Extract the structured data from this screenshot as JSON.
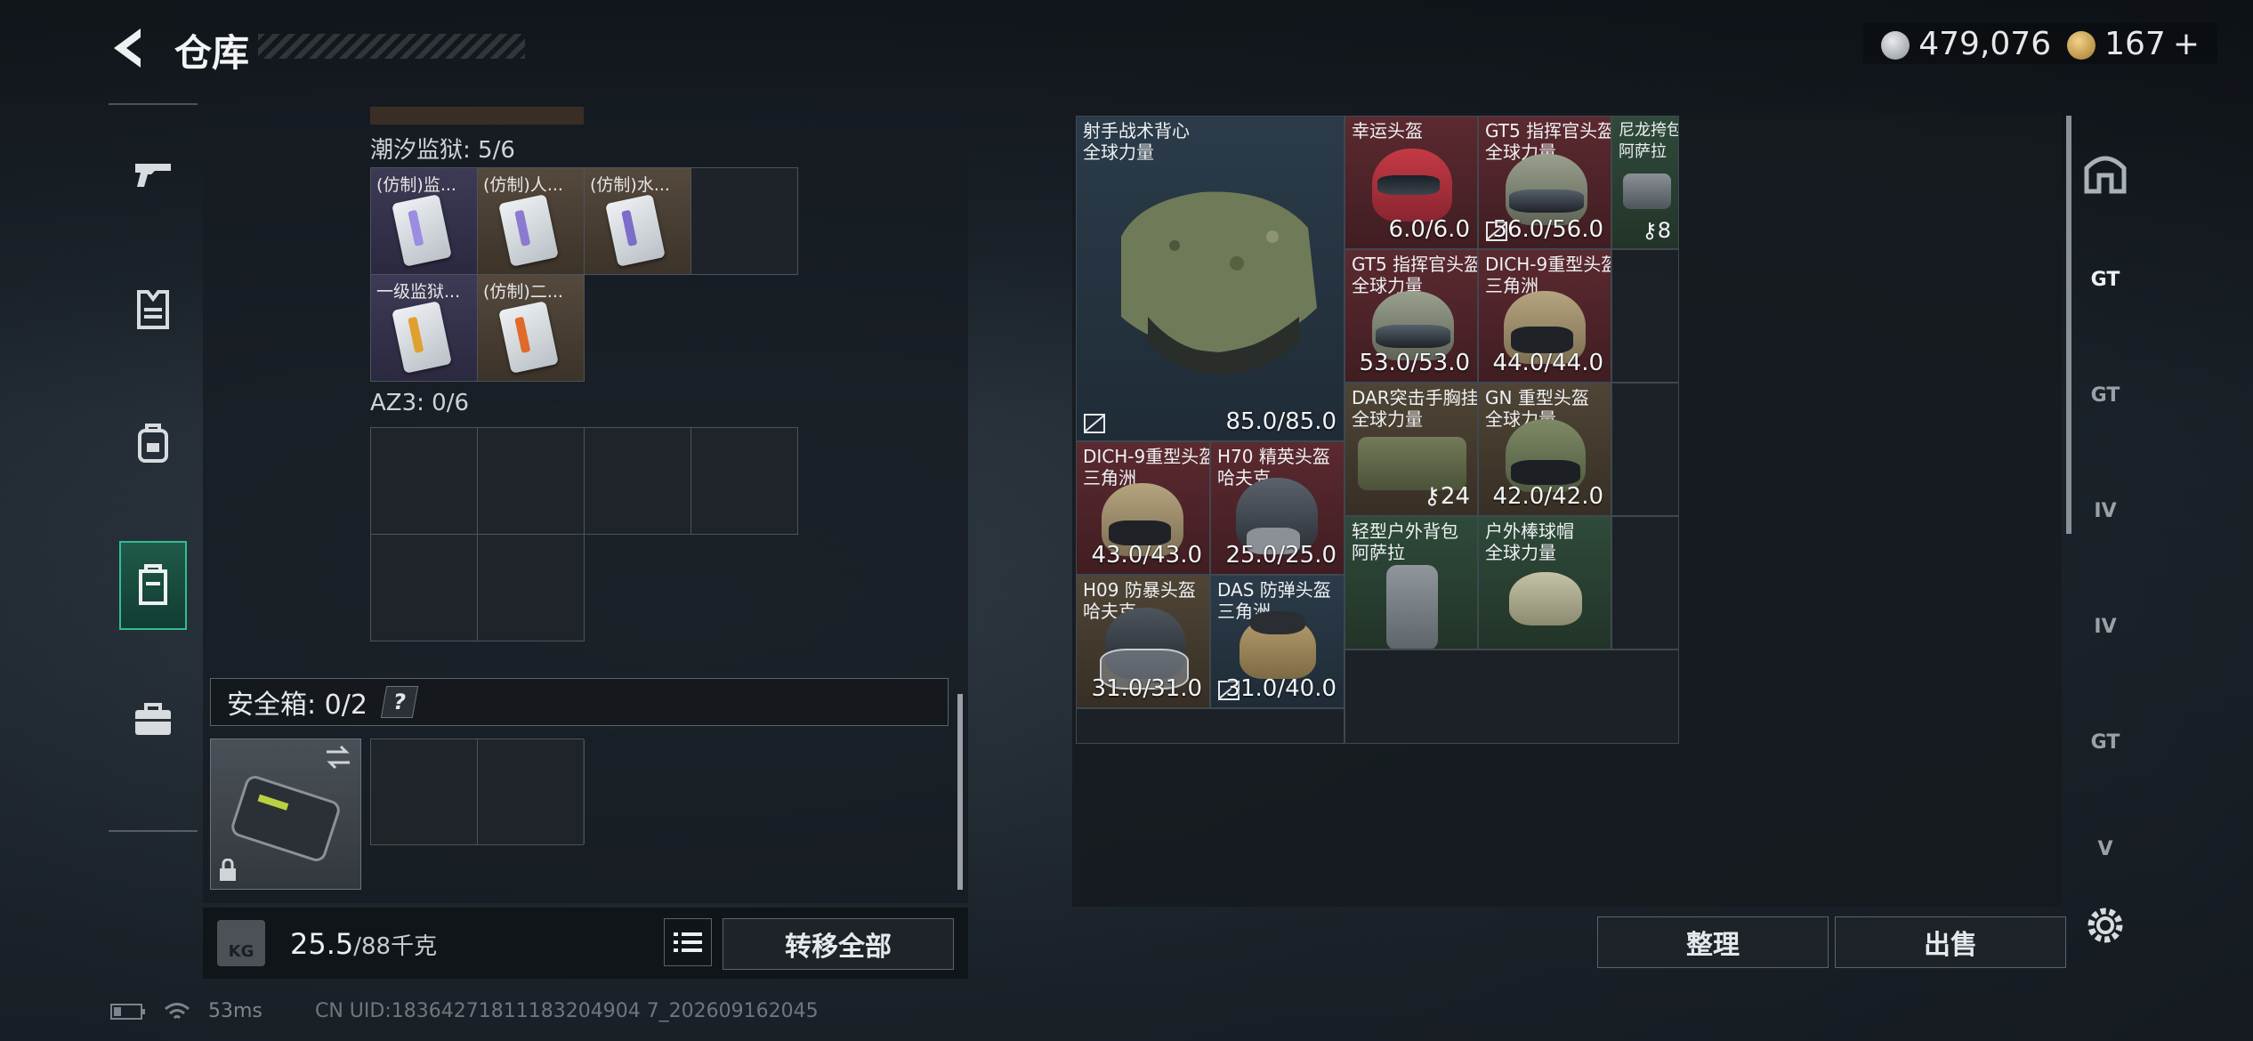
{
  "header": {
    "title": "仓库",
    "silver_amount": "479,076",
    "gold_amount": "167",
    "gold_plus": "+"
  },
  "left_panel": {
    "section1_label": "潮汐监狱: 5/6",
    "section1_items": [
      {
        "name": "(仿制)监...",
        "rarity": "purple",
        "stripe": "#9b8de0"
      },
      {
        "name": "(仿制)人...",
        "rarity": "brown",
        "stripe": "#8c7ad0"
      },
      {
        "name": "(仿制)水...",
        "rarity": "brown",
        "stripe": "#7b6dc8"
      },
      {
        "name": "一级监狱...",
        "rarity": "purple",
        "stripe": "#e0a030"
      },
      {
        "name": "(仿制)二...",
        "rarity": "brown",
        "stripe": "#e06a2a"
      }
    ],
    "section2_label": "AZ3: 0/6",
    "safe_box_label": "安全箱: 0/2",
    "help_label": "?",
    "weight_value": "25.5",
    "weight_capacity": "/88千克",
    "kg_label": "KG",
    "transfer_all_label": "转移全部"
  },
  "storage": {
    "items": [
      {
        "name": "射手战术背心\n全球力量",
        "rarity": "blue",
        "durability": "85.0/85.0",
        "broken_icon": true
      },
      {
        "name": "幸运头盔",
        "rarity": "red",
        "durability": "6.0/6.0"
      },
      {
        "name": "GT5 指挥官头盔\n全球力量",
        "rarity": "red",
        "durability": "56.0/56.0",
        "broken_icon": true
      },
      {
        "name": "尼龙挎包\n阿萨拉",
        "rarity": "green",
        "count": "8"
      },
      {
        "name": "GT5 指挥官头盔\n全球力量",
        "rarity": "red",
        "durability": "53.0/53.0"
      },
      {
        "name": "DICH-9重型头盔\n三角洲",
        "rarity": "red",
        "durability": "44.0/44.0"
      },
      {
        "name": "DICH-9重型头盔\n三角洲",
        "rarity": "red",
        "durability": "43.0/43.0"
      },
      {
        "name": "H70 精英头盔\n哈夫克",
        "rarity": "red",
        "durability": "25.0/25.0"
      },
      {
        "name": "DAR突击手胸挂\n全球力量",
        "rarity": "brown",
        "count": "24"
      },
      {
        "name": "GN 重型头盔\n全球力量",
        "rarity": "brown",
        "durability": "42.0/42.0"
      },
      {
        "name": "H09 防暴头盔\n哈夫克",
        "rarity": "brown",
        "durability": "31.0/31.0"
      },
      {
        "name": "DAS 防弹头盔\n三角洲",
        "rarity": "blue",
        "durability": "31.0/40.0",
        "broken_icon": true
      },
      {
        "name": "轻型户外背包\n阿萨拉",
        "rarity": "green"
      },
      {
        "name": "户外棒球帽\n全球力量",
        "rarity": "green"
      }
    ],
    "sort_label": "整理",
    "sell_label": "出售"
  },
  "right_rail": {
    "tab_labels": [
      "GT",
      "GT",
      "IV",
      "IV",
      "GT",
      "V"
    ]
  },
  "status_bar": {
    "ping": "53ms",
    "uid": "CN UID:18364271811183204904 7_202609162045"
  },
  "icons": [
    "back-arrow-icon",
    "silver-coin-icon",
    "gold-coin-icon",
    "gun-icon",
    "armor-icon",
    "backpack-icon",
    "chest-rig-icon",
    "briefcase-icon",
    "list-icon",
    "gear-icon",
    "battery-icon",
    "wifi-icon",
    "lock-icon",
    "swap-icon"
  ]
}
